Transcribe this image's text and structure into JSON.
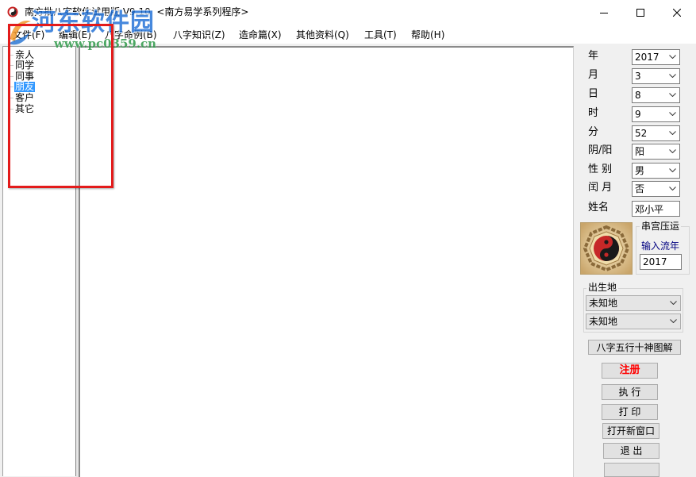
{
  "window": {
    "title": "南方批八字软件试用版 V9.10  <南方易学系列程序>",
    "app_icon": "taiji-app-icon",
    "controls": [
      "minimize-icon",
      "maximize-icon",
      "close-icon"
    ]
  },
  "watermark": {
    "brand": "河东软件园",
    "url": "www.pc0359.cn",
    "logo": "watermark-logo-icon"
  },
  "menu": {
    "items": [
      {
        "label": "文件(F)"
      },
      {
        "label": "编辑(E)"
      },
      {
        "label": "八字命例(B)"
      },
      {
        "label": "八字知识(Z)"
      },
      {
        "label": "造命篇(X)"
      },
      {
        "label": "其他资料(Q)"
      },
      {
        "label": "工具(T)"
      },
      {
        "label": "帮助(H)"
      }
    ]
  },
  "tree": {
    "items": [
      {
        "label": "亲人",
        "selected": false
      },
      {
        "label": "同学",
        "selected": false
      },
      {
        "label": "同事",
        "selected": false
      },
      {
        "label": "朋友",
        "selected": true
      },
      {
        "label": "客户",
        "selected": false
      },
      {
        "label": "其它",
        "selected": false
      }
    ]
  },
  "form": {
    "year": {
      "label": "年",
      "value": "2017"
    },
    "month": {
      "label": "月",
      "value": "3"
    },
    "day": {
      "label": "日",
      "value": "8"
    },
    "hour": {
      "label": "时",
      "value": "9"
    },
    "minute": {
      "label": "分",
      "value": "52"
    },
    "calendar": {
      "label": "阴/阳",
      "value": "阳"
    },
    "gender": {
      "label": "性 别",
      "value": "男"
    },
    "leap_month": {
      "label": "闰 月",
      "value": "否"
    },
    "name": {
      "label": "姓名",
      "value": "邓小平"
    }
  },
  "bagua_image": "taiji-bagua-icon",
  "chuangong": {
    "title": "串宫压运",
    "flow_year_label": "输入流年",
    "flow_year_value": "2017"
  },
  "birthplace": {
    "title": "出生地",
    "province": "未知地",
    "city": "未知地"
  },
  "buttons": {
    "diagram": "八字五行十神图解",
    "register": "注册",
    "execute": "执 行",
    "print": "打 印",
    "new_window": "打开新窗口",
    "exit": "退 出"
  },
  "colors": {
    "selection": "#3399ff",
    "register_text": "#ff0000",
    "flow_year_label": "#000080",
    "watermark_blue": "#1e6fd6",
    "watermark_green": "#2f9a4a",
    "annotation_red": "#e31b1b"
  }
}
